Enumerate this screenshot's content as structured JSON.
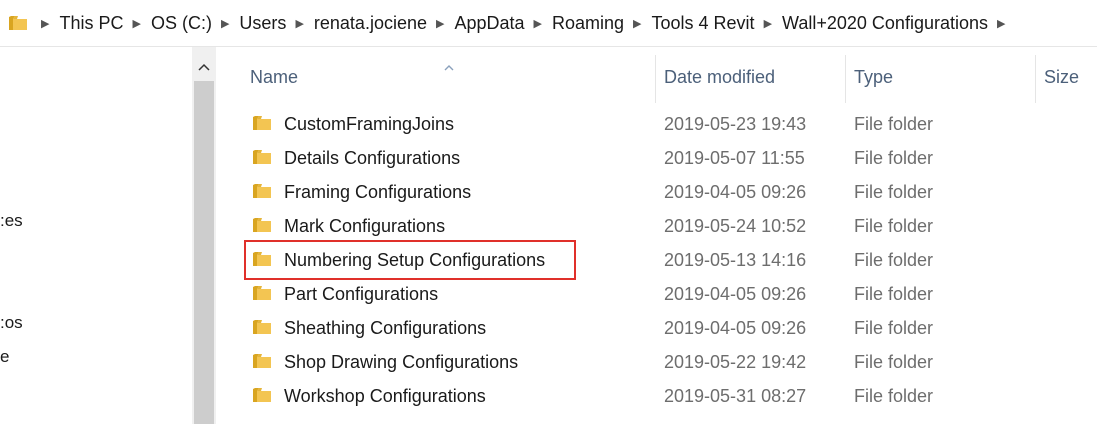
{
  "address_bar": {
    "crumbs": [
      "This PC",
      "OS (C:)",
      "Users",
      "renata.jociene",
      "AppData",
      "Roaming",
      "Tools 4 Revit",
      "Wall+2020 Configurations"
    ]
  },
  "nav_pane": {
    "fragments": [
      ":es",
      ":os",
      "e"
    ]
  },
  "columns": {
    "name": "Name",
    "date_modified": "Date modified",
    "type": "Type",
    "size": "Size"
  },
  "rows": [
    {
      "name": "CustomFramingJoins",
      "date": "2019-05-23 19:43",
      "type": "File folder"
    },
    {
      "name": "Details Configurations",
      "date": "2019-05-07 11:55",
      "type": "File folder"
    },
    {
      "name": "Framing Configurations",
      "date": "2019-04-05 09:26",
      "type": "File folder"
    },
    {
      "name": "Mark Configurations",
      "date": "2019-05-24 10:52",
      "type": "File folder"
    },
    {
      "name": "Numbering Setup Configurations",
      "date": "2019-05-13 14:16",
      "type": "File folder",
      "highlighted": true
    },
    {
      "name": "Part Configurations",
      "date": "2019-04-05 09:26",
      "type": "File folder"
    },
    {
      "name": "Sheathing Configurations",
      "date": "2019-04-05 09:26",
      "type": "File folder"
    },
    {
      "name": "Shop Drawing Configurations",
      "date": "2019-05-22 19:42",
      "type": "File folder"
    },
    {
      "name": "Workshop Configurations",
      "date": "2019-05-31 08:27",
      "type": "File folder"
    }
  ],
  "icons": {
    "folder": "folder-icon",
    "chevron": "chevron-right-icon",
    "sort": "sort-ascending-icon",
    "scroll_up": "scroll-up-icon"
  },
  "colors": {
    "header_text": "#4c607a",
    "highlight_border": "#e0302a",
    "folder_yellow": "#f3c552"
  }
}
